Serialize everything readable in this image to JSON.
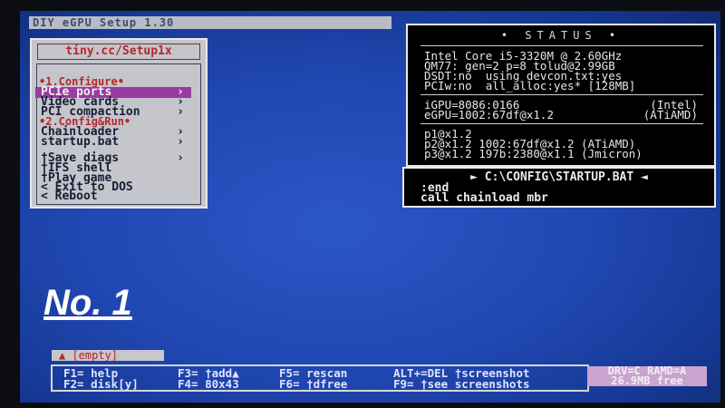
{
  "title_bar": "DIY eGPU Setup 1.30",
  "menu": {
    "header": "tiny.cc/Setup1x",
    "section1": "•1.Configure•",
    "items_configure": [
      {
        "label": "PCIe ports",
        "selected": true
      },
      {
        "label": "Video cards",
        "selected": false
      },
      {
        "label": "PCI compaction",
        "selected": false
      }
    ],
    "section2": "•2.Config&Run•",
    "items_run": [
      {
        "label": "Chainloader"
      },
      {
        "label": "startup.bat"
      }
    ],
    "items_misc": [
      {
        "label": "†Save diags"
      },
      {
        "label": "†IFS shell"
      },
      {
        "label": "†Play game"
      },
      {
        "label": "< Exit to DOS"
      },
      {
        "label": "< Reboot"
      }
    ]
  },
  "status": {
    "title": "• STATUS •",
    "cpu": "Intel Core i5-3320M @ 2.60GHz",
    "chipset": "QM77: gen=2 p=8 tolud@2.99GB",
    "dsdt": "DSDT:no  using devcon.txt:yes",
    "pciw": "PCIw:no  all_alloc:yes* [128MB]",
    "igpu_left": "iGPU=8086:0166",
    "igpu_right": "(Intel)",
    "egpu_left": "eGPU=1002:67df@x1.2",
    "egpu_right": "(ATiAMD)",
    "p1": "p1@x1.2",
    "p2": "p2@x1.2 1002:67df@x1.2 (ATiAMD)",
    "p3": "p3@x1.2 197b:2380@x1.1 (Jmicron)"
  },
  "startup_bat": {
    "title": "► C:\\CONFIG\\STARTUP.BAT ◄",
    "line1": ":end",
    "line2": "call chainload mbr"
  },
  "overlay_label": "No. 1",
  "empty_tab": "▲ [empty]",
  "keys": {
    "col1": "F1= help\nF2= disk[y]",
    "col2": "F3= †add▲\nF4= 80x43",
    "col3": "F5= rescan\nF6= †dfree",
    "col4": "ALT+=DEL †screenshot\nF9= †see screenshots"
  },
  "drive_info": {
    "line1": "DRV=C RAMD=A",
    "line2": "26.9MB free"
  },
  "icons": {
    "arrow": "›"
  }
}
